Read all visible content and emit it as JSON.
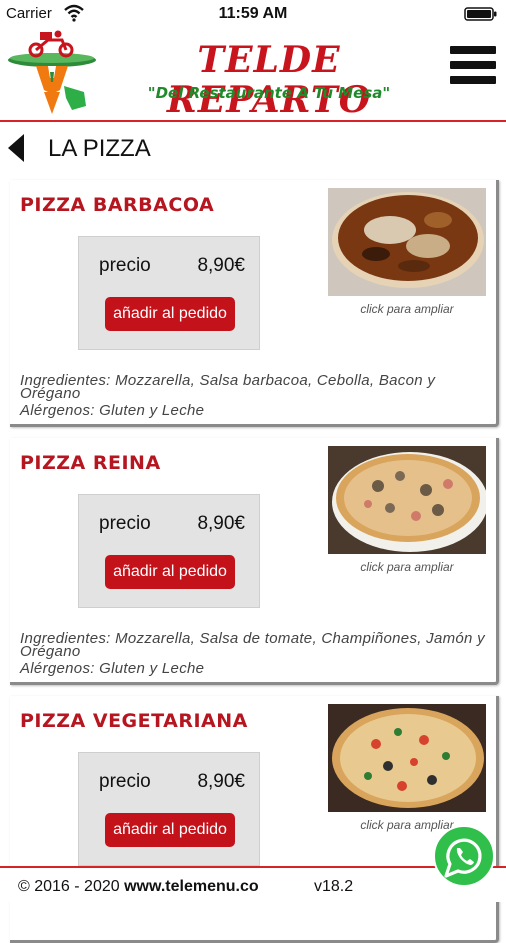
{
  "status_bar": {
    "carrier": "Carrier",
    "time": "11:59 AM"
  },
  "header": {
    "brand": "TELDE REPARTO",
    "tagline": "\"Del Restaurante A Tu Mesa\""
  },
  "section": {
    "title": "LA PIZZA"
  },
  "labels": {
    "price": "precio",
    "add": "añadir al pedido",
    "click_note": "click para ampliar"
  },
  "items": [
    {
      "name": "PIZZA BARBACOA",
      "price": "8,90€",
      "ingredients": "Ingredientes: Mozzarella, Salsa barbacoa, Cebolla, Bacon y Orégano",
      "allergens": "Alérgenos: Gluten y Leche"
    },
    {
      "name": "PIZZA REINA",
      "price": "8,90€",
      "ingredients": "Ingredientes: Mozzarella, Salsa de tomate, Champiñones, Jamón y Orégano",
      "allergens": "Alérgenos: Gluten y Leche"
    },
    {
      "name": "PIZZA VEGETARIANA",
      "price": "8,90€",
      "ingredients": "",
      "allergens": ""
    }
  ],
  "footer": {
    "copyright": "© 2016 - 2020 ",
    "site": "www.telemenu.co",
    "version": "v18.2"
  },
  "colors": {
    "brand_red": "#c8141c",
    "tagline_green": "#1f8a2a",
    "button_red": "#c4121b",
    "whatsapp_green": "#2fbf4a"
  },
  "icons": [
    "wifi-icon",
    "battery-icon",
    "delivery-logo-icon",
    "hamburger-menu-icon",
    "back-arrow-icon",
    "whatsapp-icon"
  ]
}
